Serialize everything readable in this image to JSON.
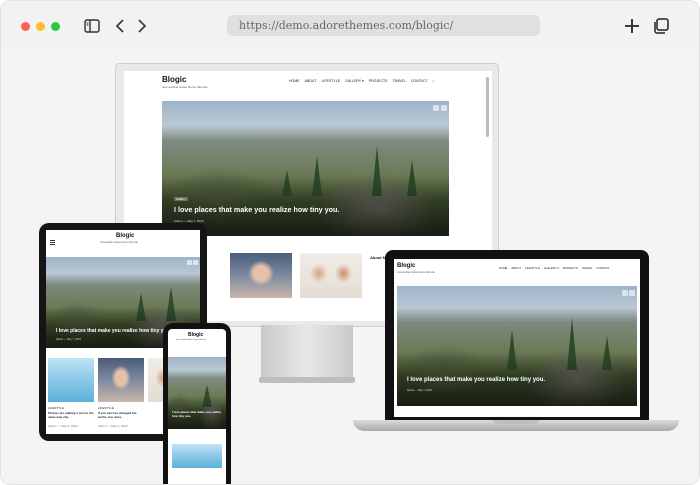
{
  "browser": {
    "url": "https://demo.adorethemes.com/blogic/",
    "traffic_lights": {
      "close": "#ff5f57",
      "minimize": "#febc2e",
      "zoom": "#28c840"
    },
    "icons": [
      "sidebar-icon",
      "back-icon",
      "forward-icon",
      "new-tab-icon",
      "tabs-overview-icon"
    ]
  },
  "site": {
    "logo": "Blogic",
    "tagline": "Just another Adore Demo Site site",
    "nav": [
      "HOME",
      "ABOUT",
      "LIFESTYLE",
      "GALLERY ▾",
      "PROJECTS",
      "TRAVEL",
      "CONTACT"
    ],
    "hero_title": "I love places that make you realize how tiny you.",
    "hero_tag": "Gallery",
    "hero_meta": "Admin  —  May 7, 2023",
    "about_label": "About M",
    "card_tag": "LIFESTYLE",
    "card1_title": "Phones are making a turn in the same way city.",
    "card2_title": "If you can't be changed the world, one more.",
    "card_meta": "Admin  —  May 3, 2023",
    "phone_title": "I love places that make you realize how tiny you."
  }
}
